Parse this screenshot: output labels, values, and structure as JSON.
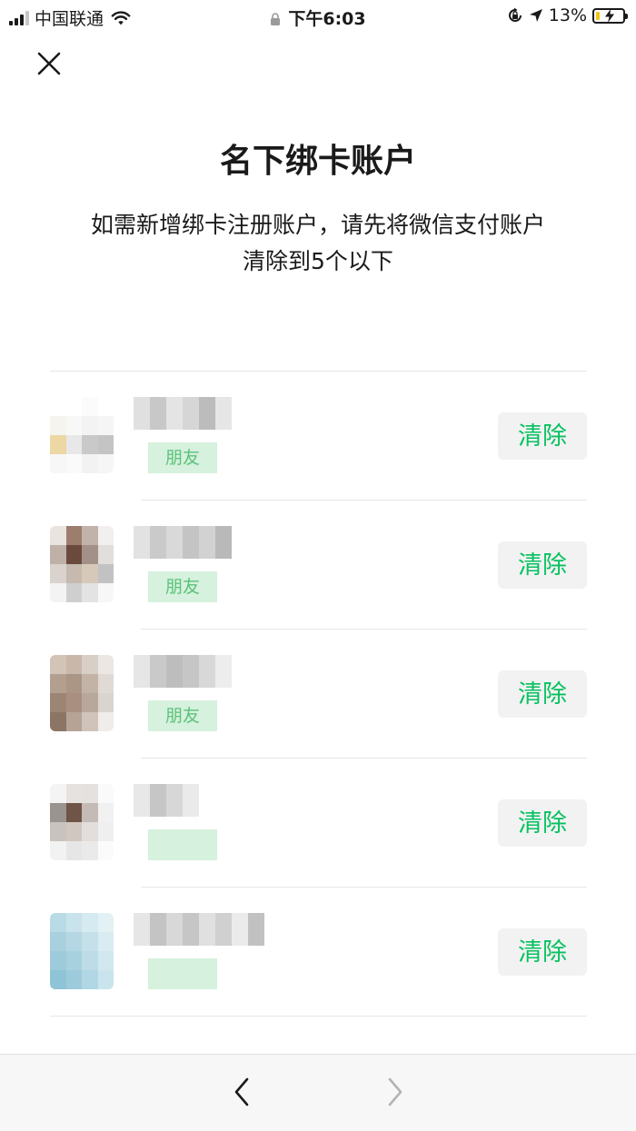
{
  "status_bar": {
    "carrier": "中国联通",
    "time": "下午6:03",
    "battery_percent": "13%",
    "icons": [
      "signal-icon",
      "wifi-icon",
      "lock-icon",
      "rotation-lock-icon",
      "location-icon",
      "battery-icon"
    ]
  },
  "header": {
    "close_icon": "close-icon",
    "title": "名下绑卡账户",
    "description_line1": "如需新增绑卡注册账户，请先将微信支付账户",
    "description_line2": "清除到5个以下"
  },
  "accounts": [
    {
      "name": "",
      "tag": "朋友",
      "clear_label": "清除"
    },
    {
      "name": "",
      "tag": "朋友",
      "clear_label": "清除"
    },
    {
      "name": "",
      "tag": "朋友",
      "clear_label": "清除"
    },
    {
      "name": "",
      "tag": "",
      "clear_label": "清除"
    },
    {
      "name": "",
      "tag": "",
      "clear_label": "清除"
    }
  ],
  "bottom_nav": {
    "back_icon": "chevron-left-icon",
    "forward_icon": "chevron-right-icon"
  },
  "colors": {
    "accent": "#07c160",
    "button_bg": "#f2f2f2",
    "nav_bg": "#f7f7f7"
  }
}
